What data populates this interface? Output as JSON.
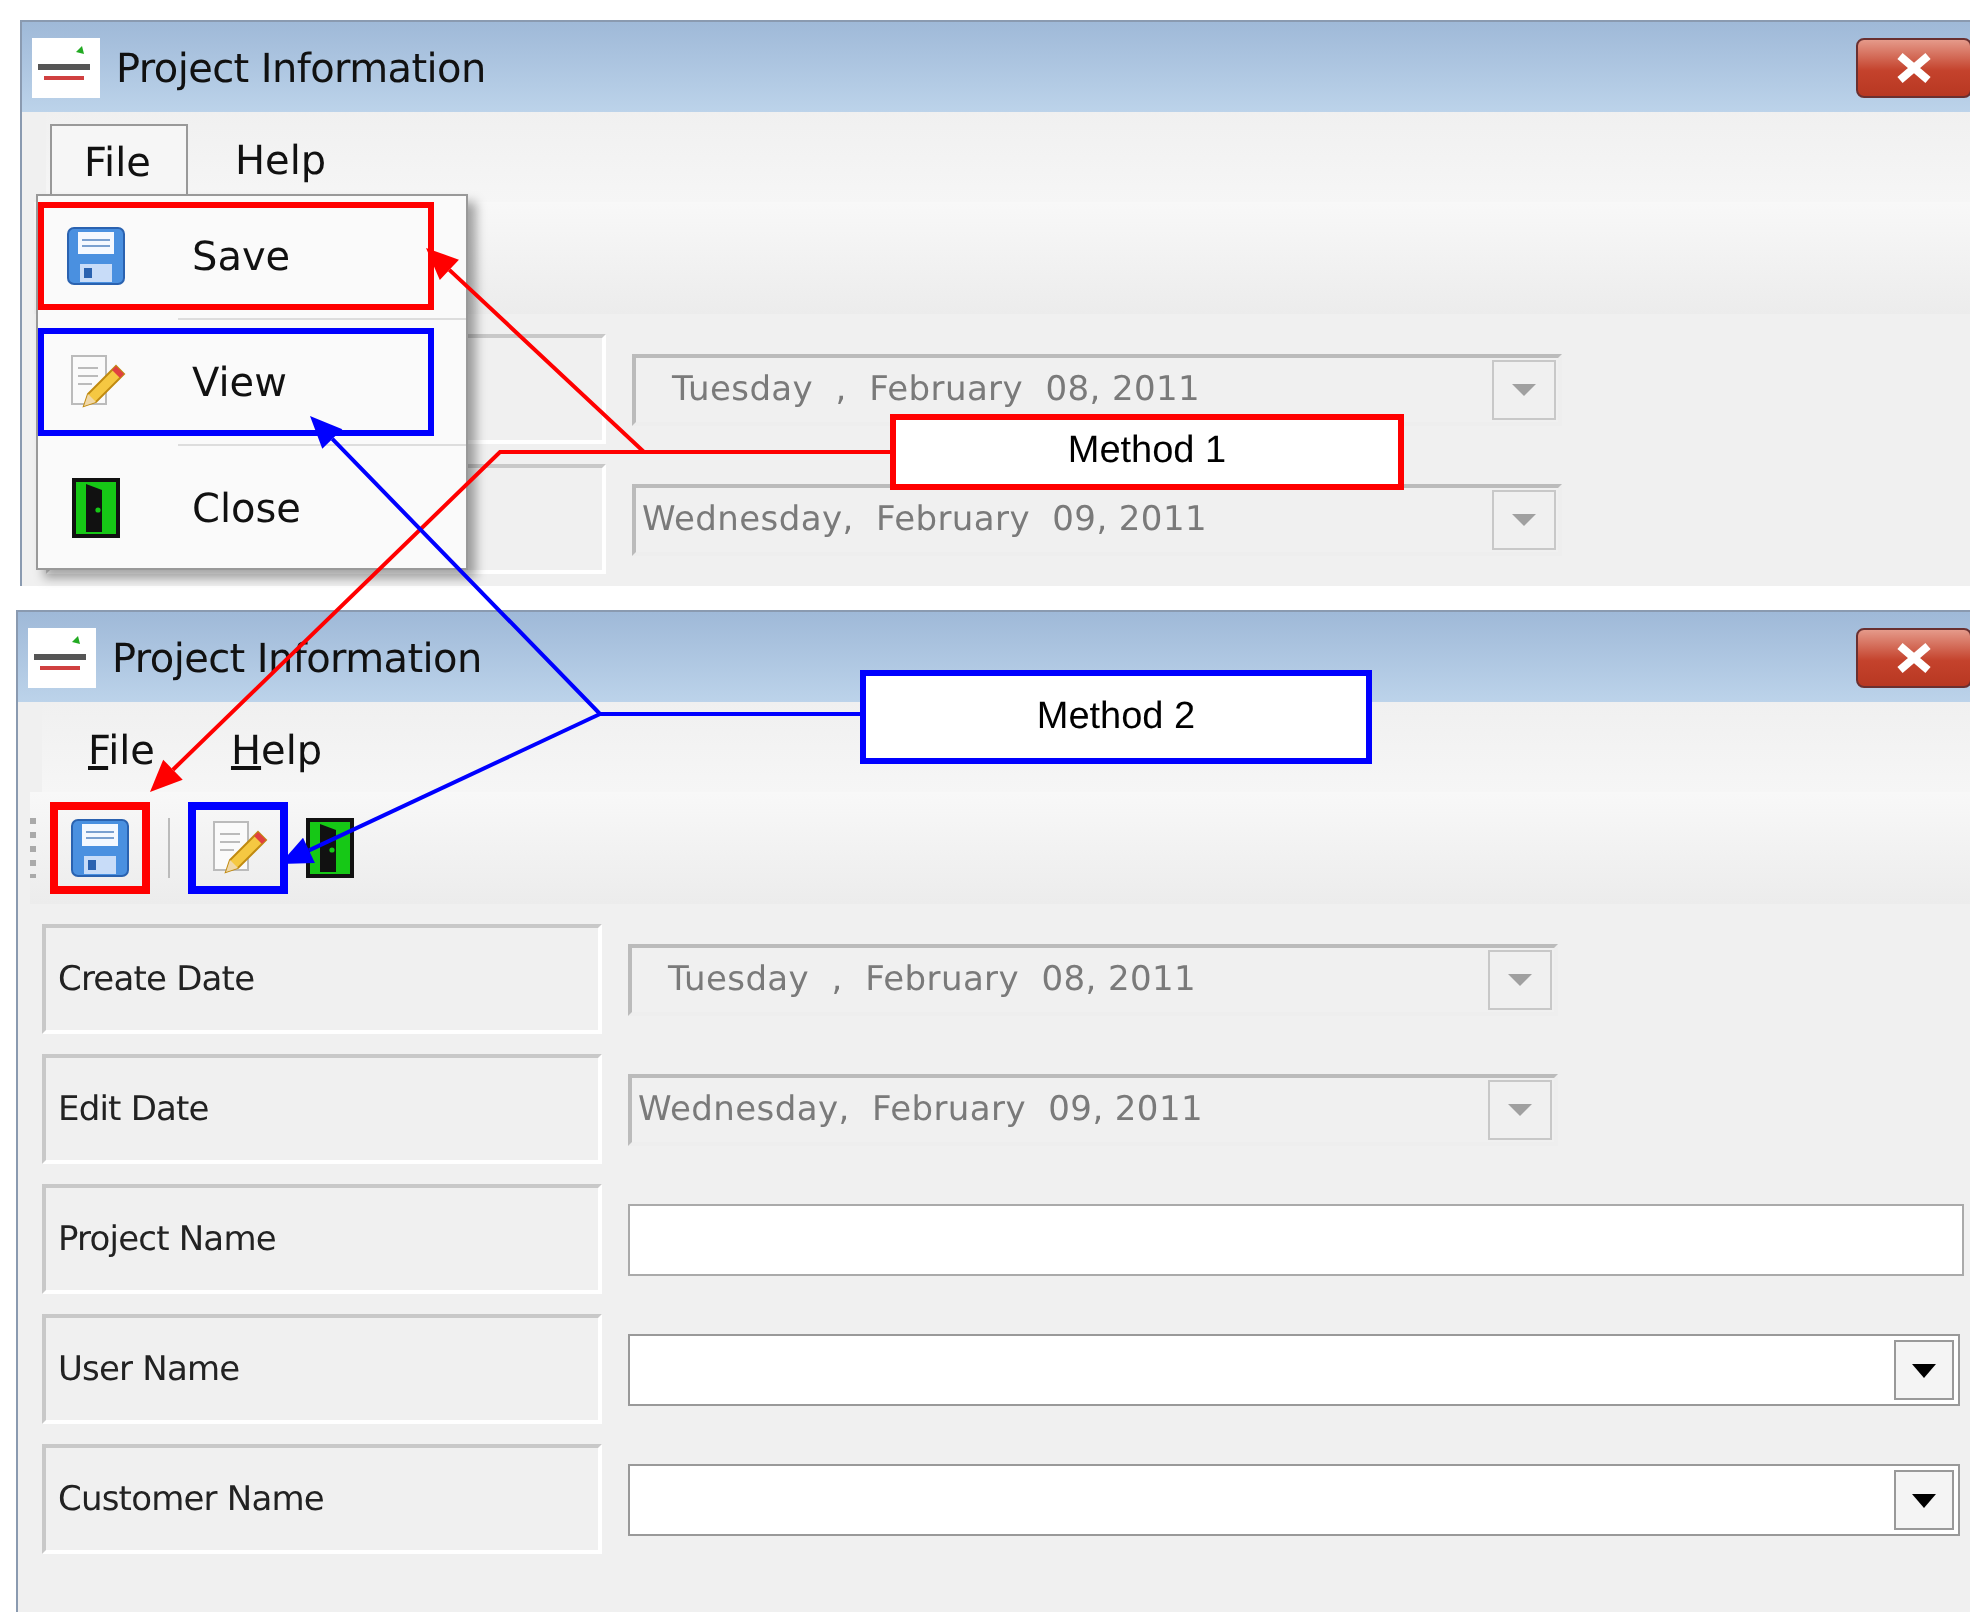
{
  "window_1": {
    "title": "Project Information",
    "menu": [
      {
        "label": "File",
        "selected": true
      },
      {
        "label": "Help",
        "selected": false
      }
    ],
    "access_key_underlined": false,
    "dropdown": [
      {
        "label": "Save",
        "kind": "save",
        "color": "#ff0000"
      },
      {
        "label": "View",
        "kind": "view",
        "color": "#0000ff"
      },
      {
        "label": "Close",
        "kind": "close"
      }
    ],
    "fields": [
      {
        "kind": "date",
        "value": "Tuesday  ,  February  08, 2011"
      },
      {
        "kind": "date",
        "value": "Wednesday,  February  09, 2011"
      }
    ]
  },
  "window_2": {
    "title": "Project Information",
    "menu": [
      {
        "label": "File",
        "selected": false
      },
      {
        "label": "Help",
        "selected": false
      }
    ],
    "access_key_underlined": true,
    "toolbar": [
      {
        "kind": "save",
        "color": "#ff0000"
      },
      {
        "kind": "view",
        "color": "#0000ff"
      },
      {
        "kind": "close"
      }
    ],
    "fields": [
      {
        "label": "Create Date",
        "kind": "date",
        "value": "Tuesday  ,  February  08, 2011"
      },
      {
        "label": "Edit Date",
        "kind": "date",
        "value": "Wednesday,  February  09, 2011"
      },
      {
        "label": "Project Name",
        "kind": "text"
      },
      {
        "label": "User Name",
        "kind": "combo"
      },
      {
        "label": "Customer Name",
        "kind": "combo"
      }
    ]
  },
  "callouts": [
    {
      "label": "Method 1",
      "color": "#ff0000"
    },
    {
      "label": "Method 2",
      "color": "#0000ff"
    }
  ]
}
